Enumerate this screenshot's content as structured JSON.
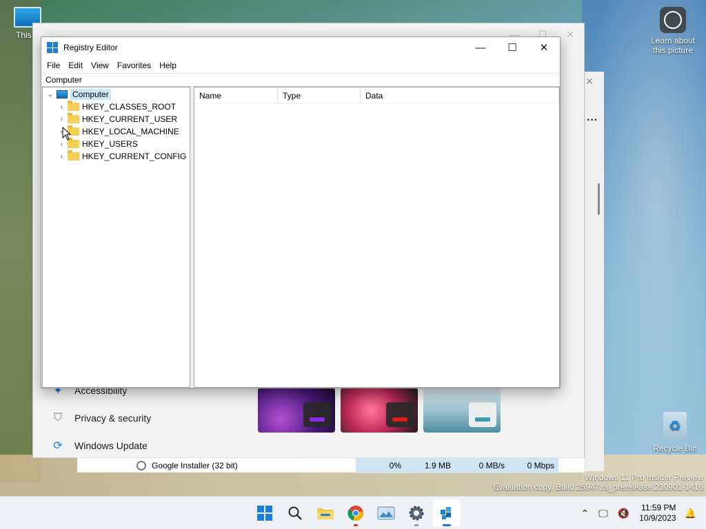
{
  "desktop": {
    "this_pc_label": "This P",
    "learn_label": "Learn about this picture",
    "recycle_label": "Recycle Bin",
    "watermark_line1": "Windows 11 Pro Insider Preview",
    "watermark_line2": "Evaluation copy. Build 25947.rs_prerelease.230901-1416"
  },
  "background": {
    "settings_items": [
      {
        "label": "Accessibility",
        "icon": "accessibility-icon"
      },
      {
        "label": "Privacy & security",
        "icon": "shield-icon"
      },
      {
        "label": "Windows Update",
        "icon": "update-icon"
      }
    ],
    "task_row": {
      "name": "Google Installer (32 bit)",
      "cpu": "0%",
      "memory": "1.9 MB",
      "disk": "0 MB/s",
      "network": "0 Mbps"
    }
  },
  "regedit": {
    "title": "Registry Editor",
    "menu": [
      "File",
      "Edit",
      "View",
      "Favorites",
      "Help"
    ],
    "address": "Computer",
    "tree": {
      "root": "Computer",
      "children": [
        "HKEY_CLASSES_ROOT",
        "HKEY_CURRENT_USER",
        "HKEY_LOCAL_MACHINE",
        "HKEY_USERS",
        "HKEY_CURRENT_CONFIG"
      ]
    },
    "columns": [
      "Name",
      "Type",
      "Data"
    ]
  },
  "taskbar": {
    "time": "11:59 PM",
    "date": "10/9/2023",
    "apps": [
      "start-icon",
      "search-icon",
      "file-explorer-icon",
      "chrome-icon",
      "photos-icon",
      "settings-icon",
      "regedit-icon"
    ]
  },
  "colors": {
    "accent": "#1a7ee0",
    "selection": "#cce8ff",
    "folder": "#f6cf58"
  }
}
